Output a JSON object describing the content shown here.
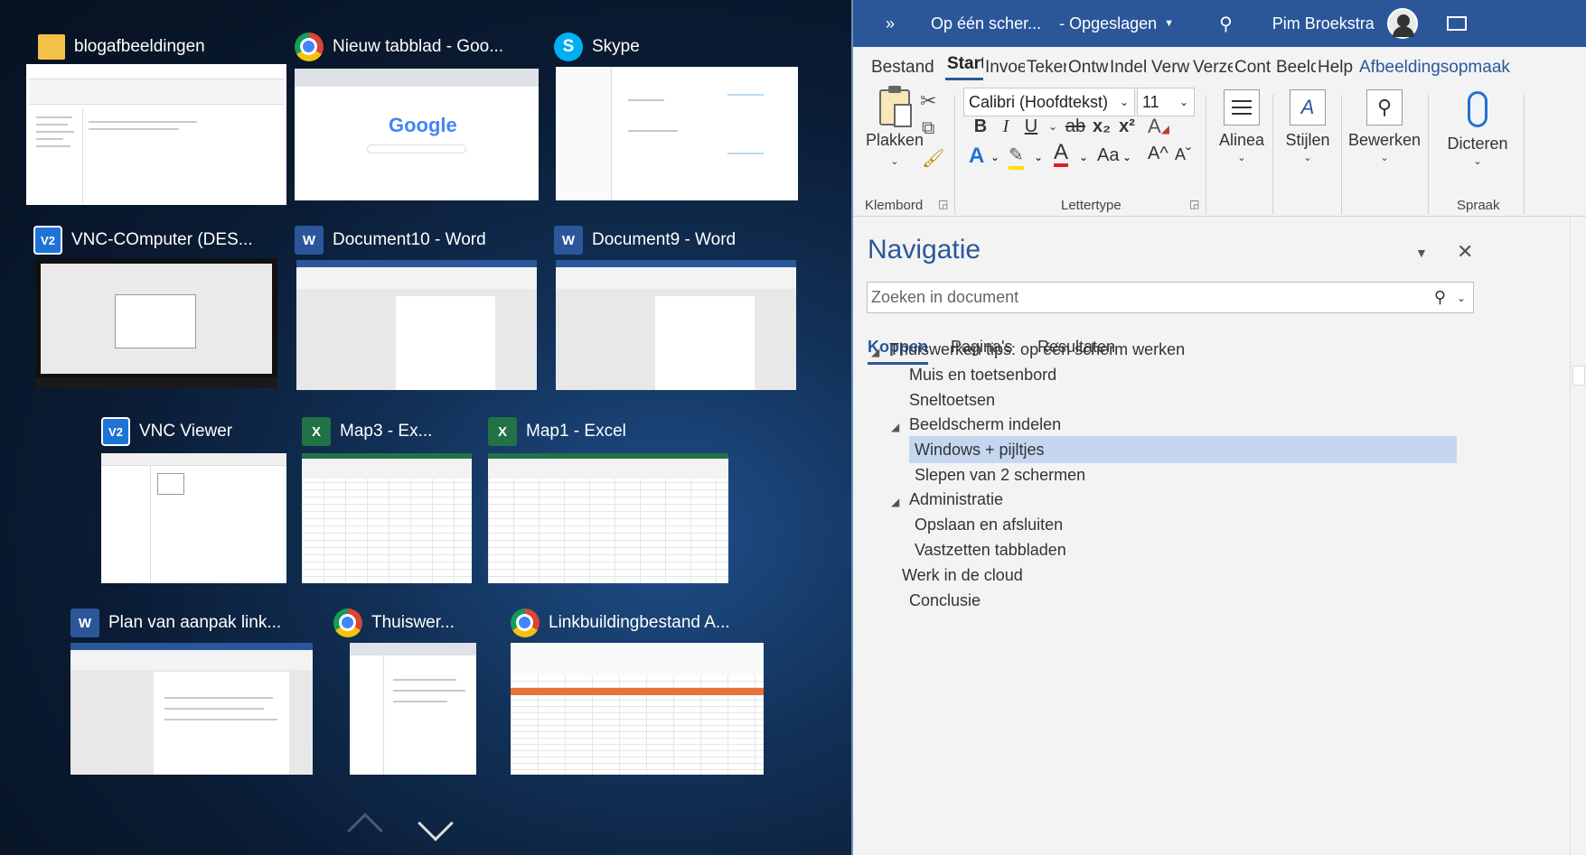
{
  "switcher": {
    "windows": [
      {
        "title": "blogafbeeldingen",
        "app": "folder"
      },
      {
        "title": "Nieuw tabblad - Goo...",
        "app": "chrome"
      },
      {
        "title": "Skype",
        "app": "skype"
      },
      {
        "title": "VNC-COmputer (DES...",
        "app": "vnc"
      },
      {
        "title": "Document10 - Word",
        "app": "word"
      },
      {
        "title": "Document9 - Word",
        "app": "word"
      },
      {
        "title": "VNC Viewer",
        "app": "vnc"
      },
      {
        "title": "Map3 - Ex...",
        "app": "excel"
      },
      {
        "title": "Map1 - Excel",
        "app": "excel"
      },
      {
        "title": "Plan van aanpak link...",
        "app": "word"
      },
      {
        "title": "Thuiswer...",
        "app": "chrome"
      },
      {
        "title": "Linkbuildingbestand A...",
        "app": "chrome"
      }
    ],
    "google_logo": "Google",
    "icon_letters": {
      "word": "W",
      "excel": "X",
      "skype": "S",
      "vnc": "V2"
    }
  },
  "word": {
    "title": {
      "expand": "»",
      "doc": "Op één scher...",
      "status": "- Opgeslagen",
      "user": "Pim Broekstra"
    },
    "tabs": [
      "Bestand",
      "Start",
      "Invoe",
      "Teken",
      "Ontw",
      "Indel",
      "Verw",
      "Verze",
      "Cont",
      "Beeld",
      "Help",
      "Afbeeldingsopmaak"
    ],
    "active_tab": "Start",
    "ribbon": {
      "paste": "Plakken",
      "font_name": "Calibri (Hoofdtekst)",
      "font_size": "11",
      "bold": "B",
      "italic": "I",
      "underline": "U",
      "strike": "ab",
      "subscript": "x₂",
      "superscript": "x²",
      "font_color": "A",
      "change_case": "Aa",
      "grow": "A^",
      "shrink": "Aˇ",
      "alinea": "Alinea",
      "stijlen": "Stijlen",
      "bewerken": "Bewerken",
      "dicteren": "Dicteren",
      "groups": {
        "klembord": "Klembord",
        "lettertype": "Lettertype",
        "spraak": "Spraak"
      }
    },
    "nav": {
      "title": "Navigatie",
      "search_placeholder": "Zoeken in document",
      "tabs": [
        "Koppen",
        "Pagina's",
        "Resultaten"
      ],
      "headings": [
        {
          "text": "Thuiswerken tips: op één scherm werken",
          "level": 1,
          "expanded": true
        },
        {
          "text": "Muis en toetsenbord",
          "level": 2
        },
        {
          "text": "Sneltoetsen",
          "level": 2
        },
        {
          "text": "Beeldscherm indelen",
          "level": 2,
          "expanded": true
        },
        {
          "text": "Windows + pijltjes",
          "level": 3,
          "selected": true
        },
        {
          "text": "Slepen van 2 schermen",
          "level": 3
        },
        {
          "text": "Administratie",
          "level": 2,
          "expanded": true
        },
        {
          "text": "Opslaan en afsluiten",
          "level": 3
        },
        {
          "text": "Vastzetten tabbladen",
          "level": 3
        },
        {
          "text": "Werk in de cloud",
          "level": 1
        },
        {
          "text": "Conclusie",
          "level": 2
        }
      ]
    }
  },
  "colors": {
    "word_blue": "#2b579a",
    "selection": "#c5d7f0"
  }
}
